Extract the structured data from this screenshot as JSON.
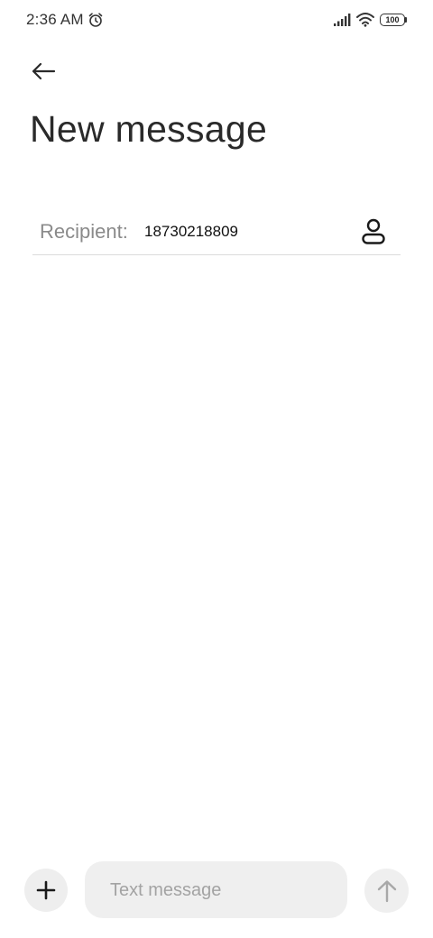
{
  "status_bar": {
    "time": "2:36 AM",
    "battery_level": "100",
    "icons": [
      "alarm-icon",
      "signal-icon",
      "wifi-icon",
      "battery-icon"
    ]
  },
  "header": {
    "back_icon": "arrow-left-icon",
    "title": "New message"
  },
  "recipient": {
    "label": "Recipient:",
    "value": "18730218809",
    "picker_icon": "person-icon"
  },
  "composer": {
    "add_icon": "plus-icon",
    "placeholder": "Text message",
    "value": "",
    "send_icon": "arrow-up-icon"
  },
  "colors": {
    "background": "#ffffff",
    "title": "#2a2a2a",
    "label_gray": "#8a8a8a",
    "input_bg": "#efefef",
    "divider": "#dcdcdc"
  }
}
